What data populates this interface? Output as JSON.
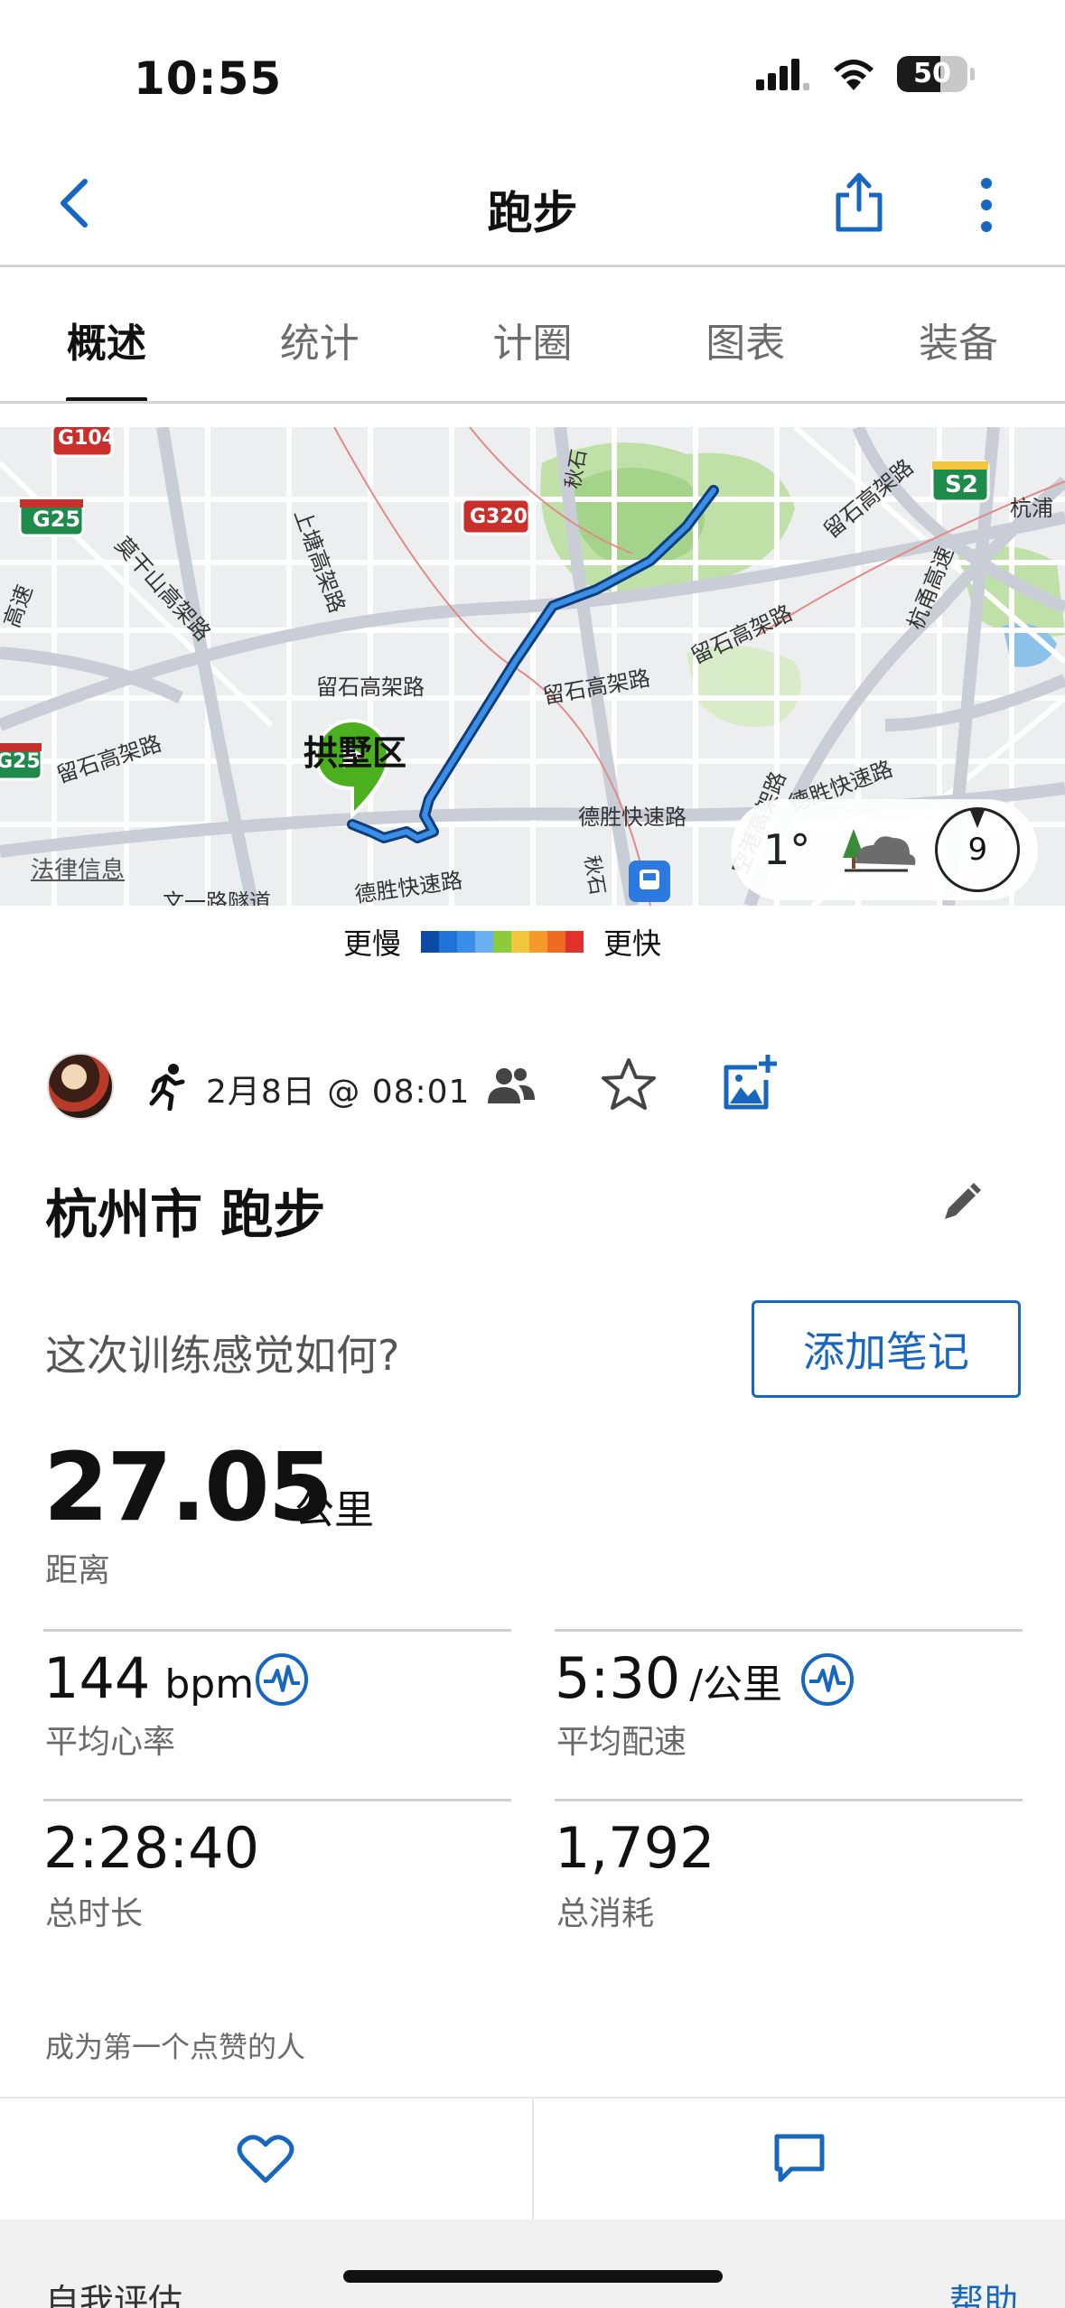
{
  "status_bar": {
    "time": "10:55",
    "battery": "50",
    "battery_level_pct": 50
  },
  "nav": {
    "title": "跑步"
  },
  "tabs": [
    {
      "label": "概述",
      "active": true
    },
    {
      "label": "统计",
      "active": false
    },
    {
      "label": "计圈",
      "active": false
    },
    {
      "label": "图表",
      "active": false
    },
    {
      "label": "装备",
      "active": false
    }
  ],
  "map": {
    "labels": {
      "g104": "G104",
      "g25": "G25",
      "g25b": "G25",
      "g320": "G320",
      "s2": "S2",
      "district": "拱墅区",
      "liushi1": "留石高架路",
      "liushi2": "留石高架路",
      "liushi3": "留石高架路",
      "liushi4": "留石高架路",
      "liushi5": "留石高架路",
      "desheng1": "德胜快速路",
      "desheng2": "德胜快速路",
      "desheng3": "德胜快速路",
      "shangtang": "上塘高架路",
      "moganshan": "莫干山高架路",
      "hangyong": "杭甬高速",
      "hangpu": "杭浦",
      "qiushi1": "秋石",
      "qiushi2": "秋石",
      "kongang": "空港高架路",
      "wenyi": "文一路隧道",
      "legal": "法律信息",
      "huanxing": "高速"
    },
    "weather": {
      "temperature": "1°",
      "wind": "9"
    }
  },
  "legend": {
    "slower": "更慢",
    "faster": "更快",
    "colors": [
      "#0d4aa6",
      "#1f72d6",
      "#3a8ee8",
      "#6ab0f0",
      "#8ccc3c",
      "#f2c53c",
      "#f29a2a",
      "#ef6a22",
      "#e0312a"
    ]
  },
  "activity": {
    "date": "2月8日 @ 08:01",
    "title": "杭州市 跑步",
    "feel_question": "这次训练感觉如何?",
    "add_note": "添加笔记"
  },
  "distance": {
    "value": "27.05",
    "unit": "公里",
    "label": "距离"
  },
  "stats": {
    "heart_rate": {
      "value": "144",
      "unit": "bpm",
      "label": "平均心率"
    },
    "pace": {
      "value": "5:30",
      "unit": "/公里",
      "label": "平均配速"
    },
    "duration": {
      "value": "2:28:40",
      "label": "总时长"
    },
    "calories": {
      "value": "1,792",
      "label": "总消耗"
    }
  },
  "social": {
    "like_first": "成为第一个点赞的人"
  },
  "footer": {
    "self_eval": "自我评估",
    "help": "帮助"
  },
  "colors": {
    "accent": "#1767c0",
    "route": "#1a6fd0",
    "start": "#4caf1e"
  }
}
